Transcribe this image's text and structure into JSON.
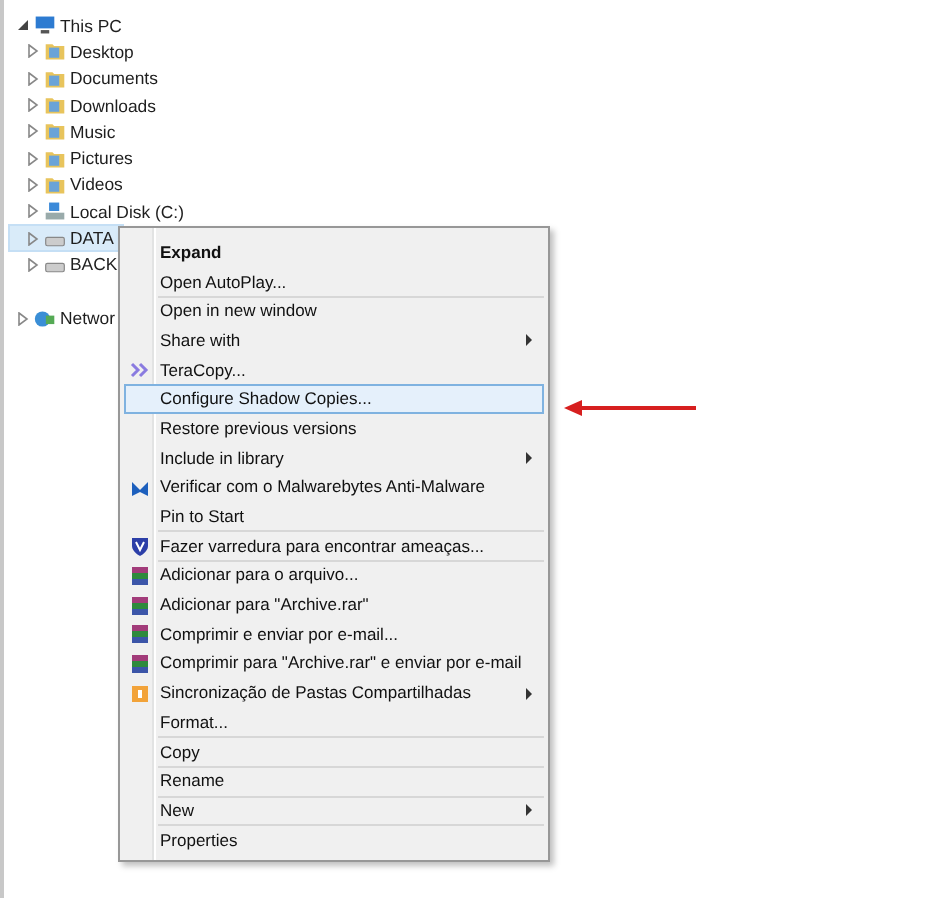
{
  "tree": [
    {
      "label": "This PC",
      "kind": "computer",
      "expanded": true,
      "selected": false,
      "children": [
        {
          "label": "Desktop",
          "kind": "folder",
          "expanded": false,
          "selected": false
        },
        {
          "label": "Documents",
          "kind": "folder",
          "expanded": false,
          "selected": false
        },
        {
          "label": "Downloads",
          "kind": "folder",
          "expanded": false,
          "selected": false
        },
        {
          "label": "Music",
          "kind": "folder",
          "expanded": false,
          "selected": false
        },
        {
          "label": "Pictures",
          "kind": "folder",
          "expanded": false,
          "selected": false
        },
        {
          "label": "Videos",
          "kind": "folder",
          "expanded": false,
          "selected": false
        },
        {
          "label": "Local Disk (C:)",
          "kind": "system",
          "expanded": false,
          "selected": false
        },
        {
          "label": "DATA",
          "kind": "drive",
          "expanded": false,
          "selected": true
        },
        {
          "label": "BACK",
          "kind": "drive",
          "expanded": false,
          "selected": false
        }
      ]
    },
    {
      "label": "Networ",
      "kind": "network",
      "expanded": false,
      "selected": false
    }
  ],
  "context_menu": [
    {
      "kind": "plain",
      "label": "Expand",
      "bold": true,
      "submenu": false,
      "selected": false
    },
    {
      "kind": "plain",
      "label": "Open AutoPlay...",
      "bold": false,
      "submenu": false,
      "selected": false
    },
    {
      "kind": "separator"
    },
    {
      "kind": "plain",
      "label": "Open in new window",
      "bold": false,
      "submenu": false,
      "selected": false
    },
    {
      "kind": "plain",
      "label": "Share with",
      "bold": false,
      "submenu": true,
      "selected": false
    },
    {
      "kind": "teracopy",
      "label": "TeraCopy...",
      "bold": false,
      "submenu": false,
      "selected": false
    },
    {
      "kind": "plain",
      "label": "Configure Shadow Copies...",
      "bold": false,
      "submenu": false,
      "selected": true
    },
    {
      "kind": "plain",
      "label": "Restore previous versions",
      "bold": false,
      "submenu": false,
      "selected": false
    },
    {
      "kind": "plain",
      "label": "Include in library",
      "bold": false,
      "submenu": true,
      "selected": false
    },
    {
      "kind": "malwarebytes",
      "label": "Verificar com o Malwarebytes Anti-Malware",
      "bold": false,
      "submenu": false,
      "selected": false
    },
    {
      "kind": "plain",
      "label": "Pin to Start",
      "bold": false,
      "submenu": false,
      "selected": false
    },
    {
      "kind": "separator"
    },
    {
      "kind": "shield",
      "label": "Fazer varredura para encontrar ameaças...",
      "bold": false,
      "submenu": false,
      "selected": false
    },
    {
      "kind": "separator"
    },
    {
      "kind": "winrar",
      "label": "Adicionar para o arquivo...",
      "bold": false,
      "submenu": false,
      "selected": false
    },
    {
      "kind": "winrar",
      "label": "Adicionar para \"Archive.rar\"",
      "bold": false,
      "submenu": false,
      "selected": false
    },
    {
      "kind": "winrar",
      "label": "Comprimir e enviar por e-mail...",
      "bold": false,
      "submenu": false,
      "selected": false
    },
    {
      "kind": "winrar",
      "label": "Comprimir para \"Archive.rar\" e enviar por e-mail",
      "bold": false,
      "submenu": false,
      "selected": false
    },
    {
      "kind": "sync",
      "label": "Sincronização de Pastas Compartilhadas",
      "bold": false,
      "submenu": true,
      "selected": false
    },
    {
      "kind": "plain",
      "label": "Format...",
      "bold": false,
      "submenu": false,
      "selected": false
    },
    {
      "kind": "separator"
    },
    {
      "kind": "plain",
      "label": "Copy",
      "bold": false,
      "submenu": false,
      "selected": false
    },
    {
      "kind": "separator"
    },
    {
      "kind": "plain",
      "label": "Rename",
      "bold": false,
      "submenu": false,
      "selected": false
    },
    {
      "kind": "separator"
    },
    {
      "kind": "plain",
      "label": "New",
      "bold": false,
      "submenu": true,
      "selected": false
    },
    {
      "kind": "separator"
    },
    {
      "kind": "plain",
      "label": "Properties",
      "bold": false,
      "submenu": false,
      "selected": false
    }
  ]
}
